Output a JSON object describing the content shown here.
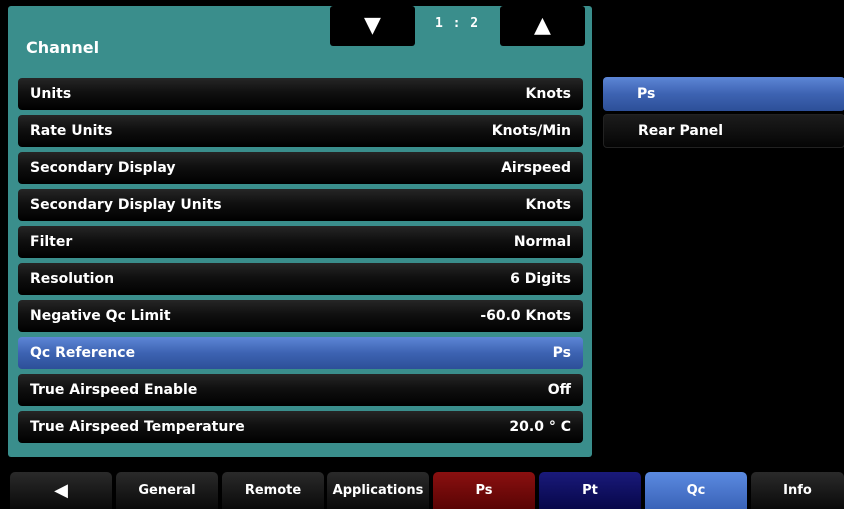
{
  "panel": {
    "title": "Channel",
    "page_indicator": "1 : 2",
    "page_down_icon": "▼",
    "page_up_icon": "▲"
  },
  "settings": [
    {
      "label": "Units",
      "value": "Knots",
      "selected": false
    },
    {
      "label": "Rate Units",
      "value": "Knots/Min",
      "selected": false
    },
    {
      "label": "Secondary Display",
      "value": "Airspeed",
      "selected": false
    },
    {
      "label": "Secondary Display Units",
      "value": "Knots",
      "selected": false
    },
    {
      "label": "Filter",
      "value": "Normal",
      "selected": false
    },
    {
      "label": "Resolution",
      "value": "6 Digits",
      "selected": false
    },
    {
      "label": "Negative Qc Limit",
      "value": "-60.0 Knots",
      "selected": false
    },
    {
      "label": "Qc Reference",
      "value": "Ps",
      "selected": true
    },
    {
      "label": "True Airspeed Enable",
      "value": "Off",
      "selected": false
    },
    {
      "label": "True Airspeed Temperature",
      "value": "20.0 ° C",
      "selected": false
    }
  ],
  "options": [
    {
      "label": "Ps",
      "selected": true
    },
    {
      "label": "Rear Panel",
      "selected": false
    }
  ],
  "tabs": {
    "back_icon": "◀",
    "general": "General",
    "remote": "Remote",
    "applications": "Applications",
    "ps": "Ps",
    "pt": "Pt",
    "qc": "Qc",
    "info": "Info"
  },
  "colors": {
    "panel_bg": "#3a8e8c",
    "selected": "#4a73c6",
    "ps_tab": "#7a0a0a",
    "pt_tab": "#10106a",
    "qc_tab": "#4a78d0"
  }
}
